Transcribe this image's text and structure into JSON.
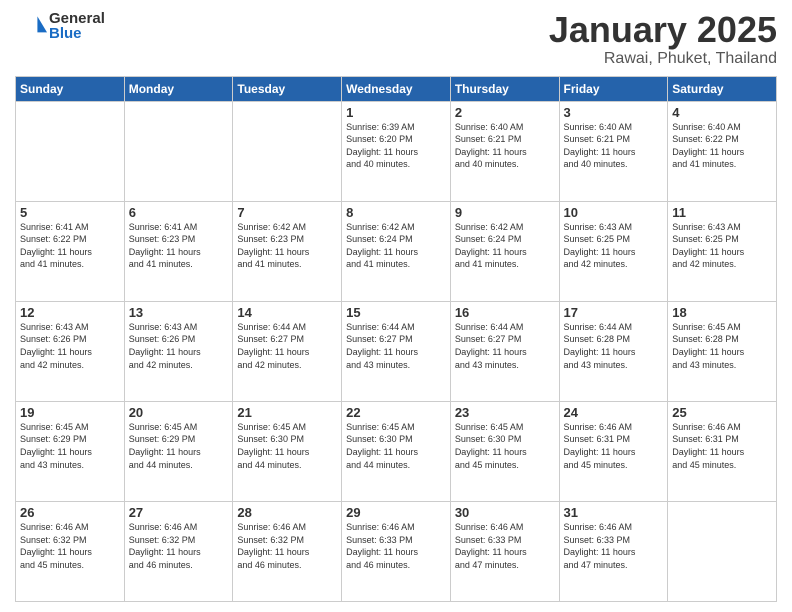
{
  "header": {
    "logo_general": "General",
    "logo_blue": "Blue",
    "month_title": "January 2025",
    "location": "Rawai, Phuket, Thailand"
  },
  "days_of_week": [
    "Sunday",
    "Monday",
    "Tuesday",
    "Wednesday",
    "Thursday",
    "Friday",
    "Saturday"
  ],
  "weeks": [
    [
      {
        "day": "",
        "info": ""
      },
      {
        "day": "",
        "info": ""
      },
      {
        "day": "",
        "info": ""
      },
      {
        "day": "1",
        "info": "Sunrise: 6:39 AM\nSunset: 6:20 PM\nDaylight: 11 hours\nand 40 minutes."
      },
      {
        "day": "2",
        "info": "Sunrise: 6:40 AM\nSunset: 6:21 PM\nDaylight: 11 hours\nand 40 minutes."
      },
      {
        "day": "3",
        "info": "Sunrise: 6:40 AM\nSunset: 6:21 PM\nDaylight: 11 hours\nand 40 minutes."
      },
      {
        "day": "4",
        "info": "Sunrise: 6:40 AM\nSunset: 6:22 PM\nDaylight: 11 hours\nand 41 minutes."
      }
    ],
    [
      {
        "day": "5",
        "info": "Sunrise: 6:41 AM\nSunset: 6:22 PM\nDaylight: 11 hours\nand 41 minutes."
      },
      {
        "day": "6",
        "info": "Sunrise: 6:41 AM\nSunset: 6:23 PM\nDaylight: 11 hours\nand 41 minutes."
      },
      {
        "day": "7",
        "info": "Sunrise: 6:42 AM\nSunset: 6:23 PM\nDaylight: 11 hours\nand 41 minutes."
      },
      {
        "day": "8",
        "info": "Sunrise: 6:42 AM\nSunset: 6:24 PM\nDaylight: 11 hours\nand 41 minutes."
      },
      {
        "day": "9",
        "info": "Sunrise: 6:42 AM\nSunset: 6:24 PM\nDaylight: 11 hours\nand 41 minutes."
      },
      {
        "day": "10",
        "info": "Sunrise: 6:43 AM\nSunset: 6:25 PM\nDaylight: 11 hours\nand 42 minutes."
      },
      {
        "day": "11",
        "info": "Sunrise: 6:43 AM\nSunset: 6:25 PM\nDaylight: 11 hours\nand 42 minutes."
      }
    ],
    [
      {
        "day": "12",
        "info": "Sunrise: 6:43 AM\nSunset: 6:26 PM\nDaylight: 11 hours\nand 42 minutes."
      },
      {
        "day": "13",
        "info": "Sunrise: 6:43 AM\nSunset: 6:26 PM\nDaylight: 11 hours\nand 42 minutes."
      },
      {
        "day": "14",
        "info": "Sunrise: 6:44 AM\nSunset: 6:27 PM\nDaylight: 11 hours\nand 42 minutes."
      },
      {
        "day": "15",
        "info": "Sunrise: 6:44 AM\nSunset: 6:27 PM\nDaylight: 11 hours\nand 43 minutes."
      },
      {
        "day": "16",
        "info": "Sunrise: 6:44 AM\nSunset: 6:27 PM\nDaylight: 11 hours\nand 43 minutes."
      },
      {
        "day": "17",
        "info": "Sunrise: 6:44 AM\nSunset: 6:28 PM\nDaylight: 11 hours\nand 43 minutes."
      },
      {
        "day": "18",
        "info": "Sunrise: 6:45 AM\nSunset: 6:28 PM\nDaylight: 11 hours\nand 43 minutes."
      }
    ],
    [
      {
        "day": "19",
        "info": "Sunrise: 6:45 AM\nSunset: 6:29 PM\nDaylight: 11 hours\nand 43 minutes."
      },
      {
        "day": "20",
        "info": "Sunrise: 6:45 AM\nSunset: 6:29 PM\nDaylight: 11 hours\nand 44 minutes."
      },
      {
        "day": "21",
        "info": "Sunrise: 6:45 AM\nSunset: 6:30 PM\nDaylight: 11 hours\nand 44 minutes."
      },
      {
        "day": "22",
        "info": "Sunrise: 6:45 AM\nSunset: 6:30 PM\nDaylight: 11 hours\nand 44 minutes."
      },
      {
        "day": "23",
        "info": "Sunrise: 6:45 AM\nSunset: 6:30 PM\nDaylight: 11 hours\nand 45 minutes."
      },
      {
        "day": "24",
        "info": "Sunrise: 6:46 AM\nSunset: 6:31 PM\nDaylight: 11 hours\nand 45 minutes."
      },
      {
        "day": "25",
        "info": "Sunrise: 6:46 AM\nSunset: 6:31 PM\nDaylight: 11 hours\nand 45 minutes."
      }
    ],
    [
      {
        "day": "26",
        "info": "Sunrise: 6:46 AM\nSunset: 6:32 PM\nDaylight: 11 hours\nand 45 minutes."
      },
      {
        "day": "27",
        "info": "Sunrise: 6:46 AM\nSunset: 6:32 PM\nDaylight: 11 hours\nand 46 minutes."
      },
      {
        "day": "28",
        "info": "Sunrise: 6:46 AM\nSunset: 6:32 PM\nDaylight: 11 hours\nand 46 minutes."
      },
      {
        "day": "29",
        "info": "Sunrise: 6:46 AM\nSunset: 6:33 PM\nDaylight: 11 hours\nand 46 minutes."
      },
      {
        "day": "30",
        "info": "Sunrise: 6:46 AM\nSunset: 6:33 PM\nDaylight: 11 hours\nand 47 minutes."
      },
      {
        "day": "31",
        "info": "Sunrise: 6:46 AM\nSunset: 6:33 PM\nDaylight: 11 hours\nand 47 minutes."
      },
      {
        "day": "",
        "info": ""
      }
    ]
  ]
}
